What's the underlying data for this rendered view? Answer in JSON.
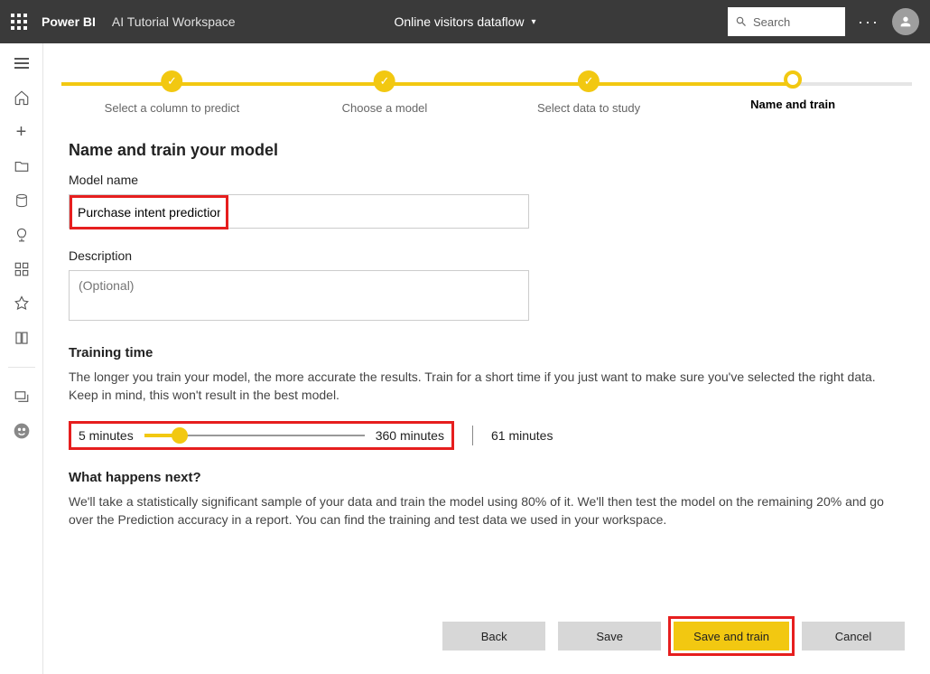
{
  "topbar": {
    "brand": "Power BI",
    "workspace": "AI Tutorial Workspace",
    "dataflow": "Online visitors dataflow",
    "search_placeholder": "Search"
  },
  "stepper": {
    "step1": "Select a column to predict",
    "step2": "Choose a model",
    "step3": "Select data to study",
    "step4": "Name and train"
  },
  "form": {
    "heading": "Name and train your model",
    "model_name_label": "Model name",
    "model_name_value": "Purchase intent prediction",
    "description_label": "Description",
    "description_placeholder": "(Optional)",
    "training_heading": "Training time",
    "training_body": "The longer you train your model, the more accurate the results. Train for a short time if you just want to make sure you've selected the right data. Keep in mind, this won't result in the best model.",
    "slider_min_label": "5 minutes",
    "slider_max_label": "360 minutes",
    "slider_value_label": "61 minutes",
    "next_heading": "What happens next?",
    "next_body": "We'll take a statistically significant sample of your data and train the model using 80% of it. We'll then test the model on the remaining 20% and go over the Prediction accuracy in a report. You can find the training and test data we used in your workspace."
  },
  "buttons": {
    "back": "Back",
    "save": "Save",
    "save_and_train": "Save and train",
    "cancel": "Cancel"
  }
}
